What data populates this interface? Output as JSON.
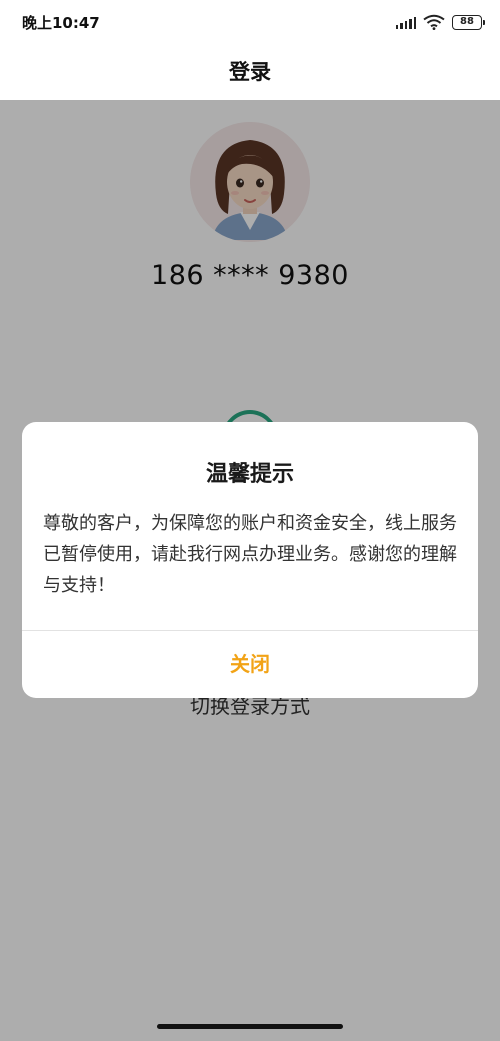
{
  "status_bar": {
    "time": "晚上10:47",
    "icons": [
      "signal-icon",
      "wifi-icon",
      "battery-icon"
    ],
    "battery_level": "88"
  },
  "header": {
    "title": "登录"
  },
  "profile": {
    "avatar": "avatar-cartoon-woman",
    "phone_number": "186 **** 9380"
  },
  "main": {
    "switch_login_label": "切换登录方式"
  },
  "dialog": {
    "title": "温馨提示",
    "message": "尊敬的客户，为保障您的账户和资金安全，线上服务已暂停使用，请赴我行网点办理业务。感谢您的理解与支持！",
    "close_label": "关闭"
  },
  "colors": {
    "accent": "#f2a316",
    "spinner": "#2aa882",
    "overlay": "rgba(0,0,0,0.32)"
  }
}
